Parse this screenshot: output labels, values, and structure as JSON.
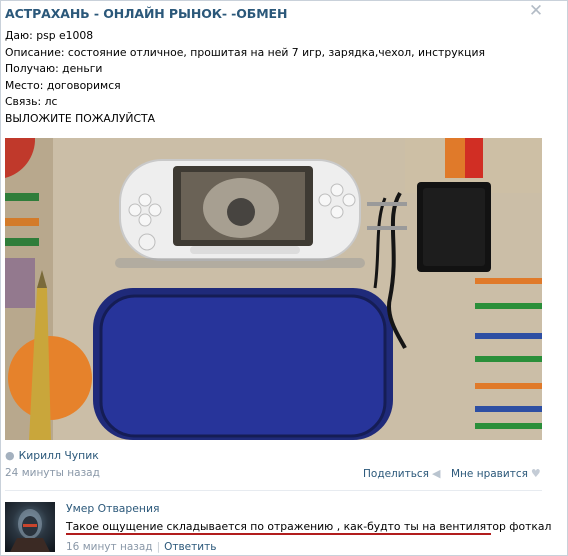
{
  "post": {
    "title": "АСТРАХАНЬ - ОНЛАЙН РЫНОК- -ОБМЕН",
    "close_symbol": "✕",
    "lines": [
      "Даю: psp e1008",
      "Описание: состояние отличное, прошитая на ней 7 игр, зарядка,чехол, инструкция",
      "Получаю: деньги",
      "Место: договоримся",
      "Связь: лс",
      "ВЫЛОЖИТЕ ПОЖАЛУЙСТА"
    ],
    "photo_icon": "psp-photo",
    "author": "Кирилл Чупик",
    "time": "24 минуты назад",
    "share_label": "Поделиться",
    "like_label": "Мне нравится"
  },
  "comment": {
    "author": "Умер Отварения",
    "text": "Такое ощущение складывается по отражению , как-будто ты на вентилятор фоткал",
    "time": "16 минут назад",
    "separator": "|",
    "reply_label": "Ответить",
    "underline_color": "#b11d1d"
  },
  "colors": {
    "link": "#2b587a",
    "muted": "#8a98a8"
  }
}
